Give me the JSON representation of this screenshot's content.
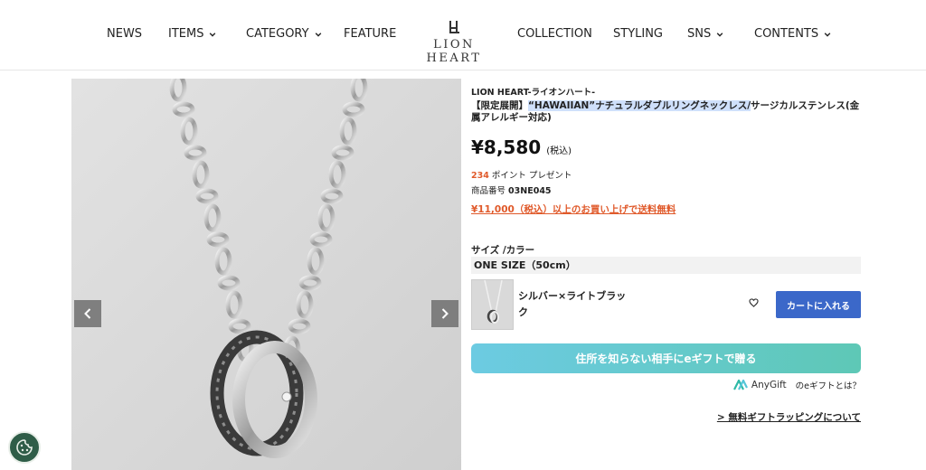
{
  "header": {
    "nav": [
      {
        "label": "NEWS",
        "has_dropdown": false
      },
      {
        "label": "ITEMS",
        "has_dropdown": true
      },
      {
        "label": "CATEGORY",
        "has_dropdown": true
      },
      {
        "label": "FEATURE",
        "has_dropdown": false
      },
      {
        "label": "COLLECTION",
        "has_dropdown": false
      },
      {
        "label": "STYLING",
        "has_dropdown": false
      },
      {
        "label": "SNS",
        "has_dropdown": true
      },
      {
        "label": "CONTENTS",
        "has_dropdown": true
      }
    ],
    "logo_text": "LION HEART"
  },
  "gallery": {
    "prev_icon": "chevron-left-icon",
    "next_icon": "chevron-right-icon"
  },
  "product": {
    "brand": "LION HEART-ライオンハート-",
    "title_prefix": "【限定展開】",
    "title_highlight": "“HAWAIIAN”ナチュラルダブルリングネックレス/",
    "title_suffix": "サージカルステンレス(金属アレルギー対応)",
    "price": "¥8,580",
    "tax_note": "(税込)",
    "points_value": "234",
    "points_label": "ポイント プレゼント",
    "sku_label": "商品番号",
    "sku": "03NE045",
    "shipping_note": "¥11,000（税込）以上のお買い上げで送料無料",
    "size_label": "サイズ /カラー",
    "size_value": "ONE SIZE（50cm）",
    "variant_name": "シルバー×ライトブラック",
    "add_to_cart": "カートに入れる",
    "egift_button": "住所を知らない相手にeギフトで贈る",
    "anygift_brand": "AnyGift",
    "anygift_question": "のeギフトとは？",
    "gift_wrapping_link": "> 無料ギフトラッピングについて"
  },
  "colors": {
    "accent_orange": "#e05a2b",
    "cart_blue": "#3b68c9",
    "gift_gradient_start": "#6ccbe2",
    "gift_gradient_end": "#5ec8b6",
    "cookie_green": "#2f5d48"
  }
}
